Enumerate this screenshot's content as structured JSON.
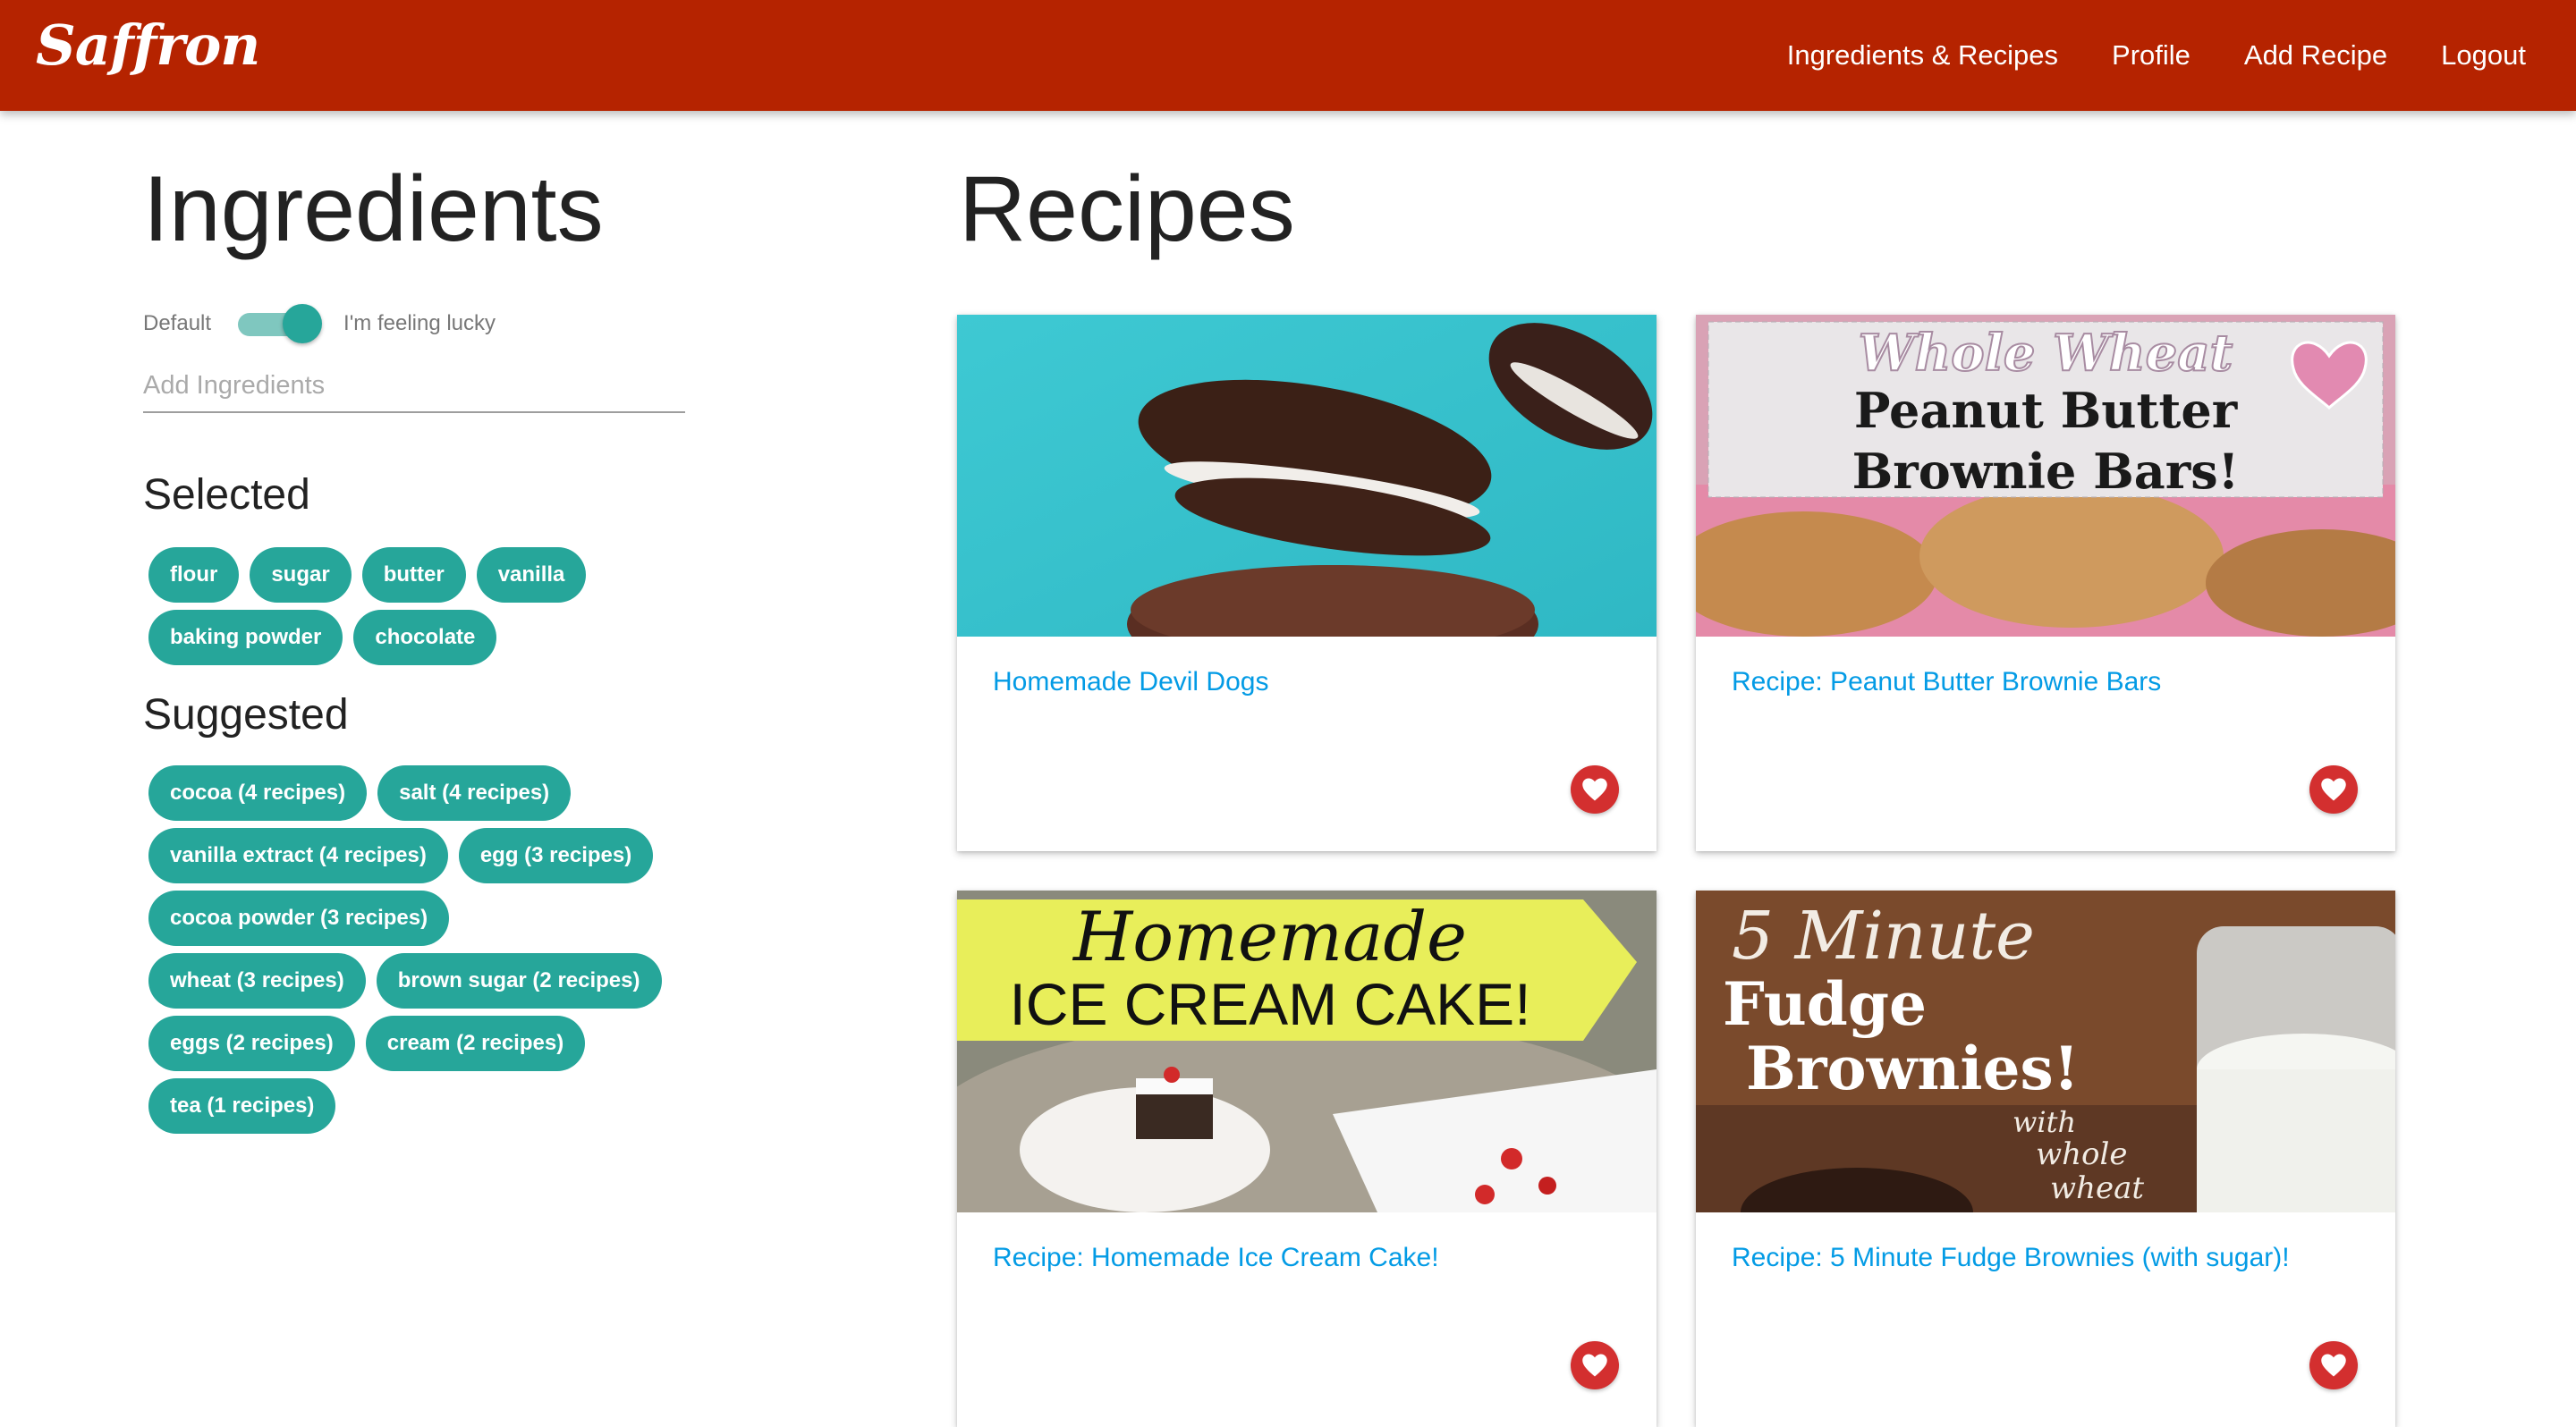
{
  "nav": {
    "brand": "Saffron",
    "links": [
      "Ingredients & Recipes",
      "Profile",
      "Add Recipe",
      "Logout"
    ]
  },
  "ingredients": {
    "title": "Ingredients",
    "toggle_left": "Default",
    "toggle_right": "I'm feeling lucky",
    "toggle_on": true,
    "input_placeholder": "Add Ingredients",
    "selected_title": "Selected",
    "selected": [
      "flour",
      "sugar",
      "butter",
      "vanilla",
      "baking powder",
      "chocolate"
    ],
    "suggested_title": "Suggested",
    "suggested": [
      "cocoa (4 recipes)",
      "salt (4 recipes)",
      "vanilla extract (4 recipes)",
      "egg (3 recipes)",
      "cocoa powder (3 recipes)",
      "wheat (3 recipes)",
      "brown sugar (2 recipes)",
      "eggs (2 recipes)",
      "cream (2 recipes)",
      "tea (1 recipes)"
    ]
  },
  "recipes": {
    "title": "Recipes",
    "cards": [
      {
        "title": "Homemade Devil Dogs"
      },
      {
        "title": "Recipe: Peanut Butter Brownie Bars",
        "image_text": [
          "Whole Wheat",
          "Peanut Butter",
          "Brownie Bars!"
        ]
      },
      {
        "title": "Recipe: Homemade Ice Cream Cake!",
        "image_text": [
          "Homemade",
          "ICE CREAM CAKE!"
        ]
      },
      {
        "title": "Recipe: 5 Minute Fudge Brownies (with sugar)!",
        "image_text": [
          "5 Minute",
          "Fudge",
          "Brownies!",
          "with",
          "whole",
          "wheat"
        ]
      }
    ]
  },
  "colors": {
    "navbar": "#b52300",
    "chip": "#26a69a",
    "link": "#039be5",
    "heart": "#d32f2f"
  }
}
